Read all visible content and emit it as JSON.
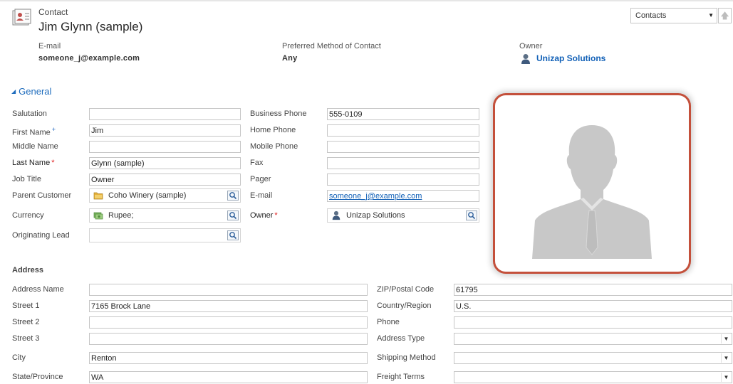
{
  "header": {
    "entity_type": "Contact",
    "record_name": "Jim Glynn (sample)",
    "form_selector": "Contacts",
    "fields": [
      {
        "label": "E-mail",
        "value": "someone_j@example.com"
      },
      {
        "label": "Preferred Method of Contact",
        "value": "Any"
      },
      {
        "label": "Owner",
        "value": "Unizap Solutions"
      }
    ]
  },
  "general": {
    "title": "General",
    "left_labels": {
      "salutation": "Salutation",
      "first_name": "First Name",
      "middle_name": "Middle Name",
      "last_name": "Last Name",
      "job_title": "Job Title",
      "parent_customer": "Parent Customer",
      "currency": "Currency",
      "originating_lead": "Originating Lead"
    },
    "left_values": {
      "salutation": "",
      "first_name": "Jim",
      "middle_name": "",
      "last_name": "Glynn (sample)",
      "job_title": "Owner",
      "parent_customer": "Coho Winery (sample)",
      "currency": "Rupee;",
      "originating_lead": ""
    },
    "right_labels": {
      "business_phone": "Business Phone",
      "home_phone": "Home Phone",
      "mobile_phone": "Mobile Phone",
      "fax": "Fax",
      "pager": "Pager",
      "email": "E-mail",
      "owner": "Owner"
    },
    "right_values": {
      "business_phone": "555-0109",
      "home_phone": "",
      "mobile_phone": "",
      "fax": "",
      "pager": "",
      "email": "someone_j@example.com",
      "owner": "Unizap Solutions"
    },
    "markers": {
      "required": "*",
      "recommended": "+"
    }
  },
  "address": {
    "title": "Address",
    "left_labels": {
      "address_name": "Address Name",
      "street1": "Street 1",
      "street2": "Street 2",
      "street3": "Street 3",
      "city": "City",
      "state": "State/Province"
    },
    "left_values": {
      "address_name": "",
      "street1": "7165 Brock Lane",
      "street2": "",
      "street3": "",
      "city": "Renton",
      "state": "WA"
    },
    "right_labels": {
      "zip": "ZIP/Postal Code",
      "country": "Country/Region",
      "phone": "Phone",
      "address_type": "Address Type",
      "shipping_method": "Shipping Method",
      "freight_terms": "Freight Terms"
    },
    "right_values": {
      "zip": "61795",
      "country": "U.S.",
      "phone": "",
      "address_type": "",
      "shipping_method": "",
      "freight_terms": ""
    }
  },
  "colors": {
    "link": "#1160b7",
    "section_title": "#1e6cbd",
    "photo_border": "#c4503b",
    "required": "#e02020"
  }
}
